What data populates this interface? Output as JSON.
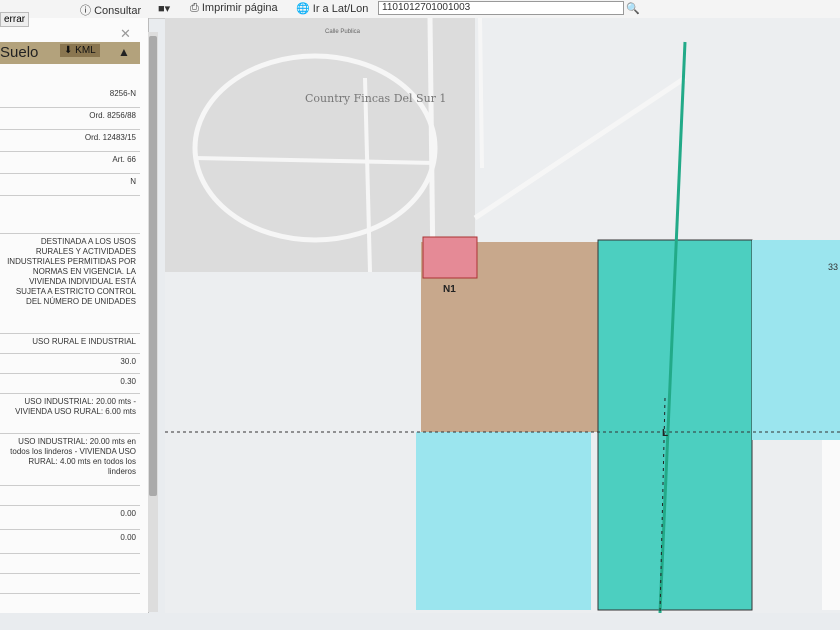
{
  "toolbar": {
    "consultar": "Consultar",
    "imprimir": "Imprimir página",
    "ir_latlon": "Ir a Lat/Lon",
    "search_value": "1101012701001003",
    "cerrar": "errar"
  },
  "panel": {
    "title": "Suelo",
    "kml": "KML",
    "rows": [
      "8256-N",
      "Ord. 8256/88",
      "Ord. 12483/15",
      "Art. 66",
      "N",
      "",
      "DESTINADA A LOS USOS RURALES Y ACTIVIDADES INDUSTRIALES PERMITIDAS POR NORMAS EN VIGENCIA. LA VIVIENDA INDIVIDUAL ESTÁ SUJETA A ESTRICTO CONTROL DEL NÚMERO DE UNIDADES",
      "USO RURAL E INDUSTRIAL",
      "30.0",
      "0.30",
      "USO INDUSTRIAL: 20.00 mts - VIVIENDA USO RURAL: 6.00 mts",
      "USO INDUSTRIAL: 20.00 mts en todos los linderos - VIVIENDA USO RURAL: 4.00 mts en todos los linderos",
      "",
      "0.00",
      "0.00",
      "",
      ""
    ]
  },
  "map": {
    "street": "Calle Publica",
    "neighborhood": "Country Fincas Del Sur 1",
    "zone_n1": "N1",
    "zone_l": "L",
    "zone_33": "33"
  }
}
